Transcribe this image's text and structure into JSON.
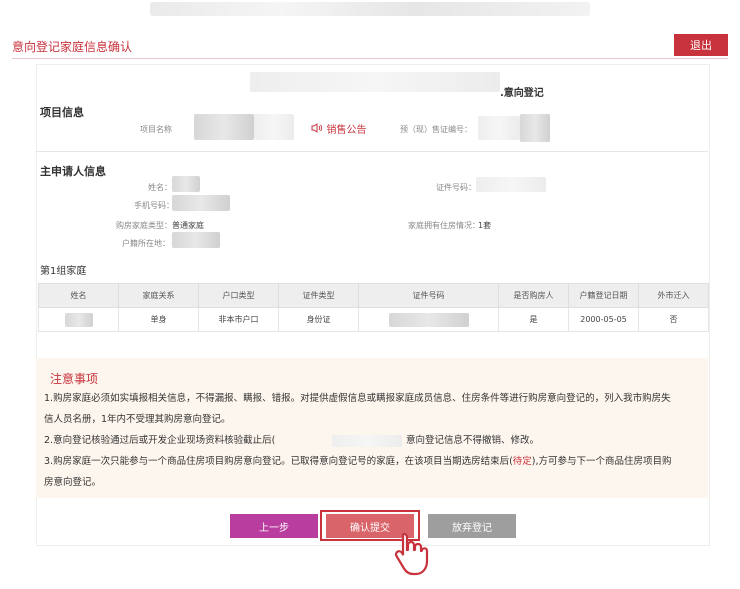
{
  "header": {
    "page_title": "意向登记家庭信息确认",
    "exit_label": "退出"
  },
  "project": {
    "section_title": "项目信息",
    "heading_suffix": ".意向登记",
    "name_label": "项目名称",
    "notice_label": "销售公告",
    "permit_label": "预（现）售证编号："
  },
  "applicant": {
    "section_title": "主申请人信息",
    "name_label": "姓名：",
    "id_label": "证件号码：",
    "phone_label": "手机号码：",
    "family_type_label": "购房家庭类型：",
    "family_type_value": "普通家庭",
    "housing_label": "家庭拥有住房情况：",
    "housing_value": "1套",
    "hukou_label": "户籍所在地："
  },
  "family_group": {
    "title": "第1组家庭",
    "headers": [
      "姓名",
      "家庭关系",
      "户口类型",
      "证件类型",
      "证件号码",
      "是否购房人",
      "户籍登记日期",
      "外市迁入"
    ],
    "row": [
      "",
      "单身",
      "非本市户口",
      "身份证",
      "",
      "是",
      "2000-05-05",
      "否"
    ]
  },
  "notes": {
    "title": "注意事项",
    "line1": "1.购房家庭必须如实填报相关信息，不得漏报、瞒报、错报。对提供虚假信息或瞒报家庭成员信息、住房条件等进行购房意向登记的，列入我市购房失",
    "line1b": "信人员名册，1年内不受理其购房意向登记。",
    "line2a": "2.意向登记核验通过后或开发企业现场资料核验截止后(",
    "line2b": "意向登记信息不得撤销、修改。",
    "line3a": "3.购房家庭一次只能参与一个商品住房项目购房意向登记。已取得意向登记号的家庭，在该项目当期选房结束后(",
    "line3_highlight": "待定",
    "line3b": "),方可参与下一个商品住房项目购",
    "line3c": "房意向登记。"
  },
  "actions": {
    "prev_label": "上一步",
    "confirm_label": "确认提交",
    "abandon_label": "放弃登记"
  },
  "colors": {
    "brand_red": "#c8323c",
    "prev_purple": "#b93c9f",
    "abandon_gray": "#9e9e9e",
    "notes_bg": "#fdf6ee"
  }
}
